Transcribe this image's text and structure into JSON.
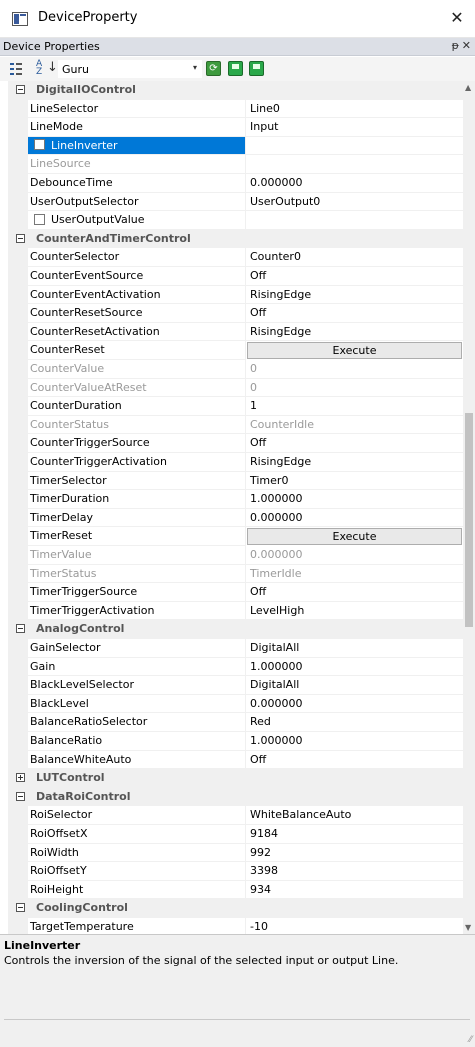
{
  "window": {
    "title": "DeviceProperty",
    "close_glyph": "✕"
  },
  "panel": {
    "header": "Device Properties",
    "pin_glyph": "ᵽ",
    "close_glyph": "✕"
  },
  "toolbar": {
    "az_label": "A\nZ",
    "visibility_value": "Guru",
    "dropdown_glyph": "▾",
    "refresh_glyph": "⟳"
  },
  "colors": {
    "selection": "#0078d7",
    "category_bg": "#f0f0f0",
    "grid_line": "#f0f0f0"
  },
  "rows": [
    {
      "kind": "cat",
      "name": "DigitalIOControl",
      "expanded": true
    },
    {
      "name": "LineSelector",
      "value": "Line0"
    },
    {
      "name": "LineMode",
      "value": "Input"
    },
    {
      "name": "LineInverter",
      "value": "",
      "checkbox": true,
      "selected": true
    },
    {
      "name": "LineSource",
      "value": "",
      "dim": true
    },
    {
      "name": "DebounceTime",
      "value": "0.000000"
    },
    {
      "name": "UserOutputSelector",
      "value": "UserOutput0"
    },
    {
      "name": "UserOutputValue",
      "value": "",
      "checkbox": true
    },
    {
      "kind": "cat",
      "name": "CounterAndTimerControl",
      "expanded": true
    },
    {
      "name": "CounterSelector",
      "value": "Counter0"
    },
    {
      "name": "CounterEventSource",
      "value": "Off"
    },
    {
      "name": "CounterEventActivation",
      "value": "RisingEdge"
    },
    {
      "name": "CounterResetSource",
      "value": "Off"
    },
    {
      "name": "CounterResetActivation",
      "value": "RisingEdge"
    },
    {
      "name": "CounterReset",
      "button": "Execute"
    },
    {
      "name": "CounterValue",
      "value": "0",
      "dim": true
    },
    {
      "name": "CounterValueAtReset",
      "value": "0",
      "dim": true
    },
    {
      "name": "CounterDuration",
      "value": "1"
    },
    {
      "name": "CounterStatus",
      "value": "CounterIdle",
      "dim": true
    },
    {
      "name": "CounterTriggerSource",
      "value": "Off"
    },
    {
      "name": "CounterTriggerActivation",
      "value": "RisingEdge"
    },
    {
      "name": "TimerSelector",
      "value": "Timer0"
    },
    {
      "name": "TimerDuration",
      "value": "1.000000"
    },
    {
      "name": "TimerDelay",
      "value": "0.000000"
    },
    {
      "name": "TimerReset",
      "button": "Execute"
    },
    {
      "name": "TimerValue",
      "value": "0.000000",
      "dim": true
    },
    {
      "name": "TimerStatus",
      "value": "TimerIdle",
      "dim": true
    },
    {
      "name": "TimerTriggerSource",
      "value": "Off"
    },
    {
      "name": "TimerTriggerActivation",
      "value": "LevelHigh"
    },
    {
      "kind": "cat",
      "name": "AnalogControl",
      "expanded": true
    },
    {
      "name": "GainSelector",
      "value": "DigitalAll"
    },
    {
      "name": "Gain",
      "value": "1.000000"
    },
    {
      "name": "BlackLevelSelector",
      "value": "DigitalAll"
    },
    {
      "name": "BlackLevel",
      "value": "0.000000"
    },
    {
      "name": "BalanceRatioSelector",
      "value": "Red"
    },
    {
      "name": "BalanceRatio",
      "value": "1.000000"
    },
    {
      "name": "BalanceWhiteAuto",
      "value": "Off"
    },
    {
      "kind": "cat",
      "name": "LUTControl",
      "expanded": false
    },
    {
      "kind": "cat",
      "name": "DataRoiControl",
      "expanded": true
    },
    {
      "name": "RoiSelector",
      "value": "WhiteBalanceAuto"
    },
    {
      "name": "RoiOffsetX",
      "value": "9184"
    },
    {
      "name": "RoiWidth",
      "value": "992"
    },
    {
      "name": "RoiOffsetY",
      "value": "3398"
    },
    {
      "name": "RoiHeight",
      "value": "934"
    },
    {
      "kind": "cat",
      "name": "CoolingControl",
      "expanded": true
    },
    {
      "name": "TargetTemperature",
      "value": "-10"
    }
  ],
  "scroll": {
    "position": 0.52
  },
  "description": {
    "title": "LineInverter",
    "text": "Controls the inversion of the signal of the selected input or output Line."
  }
}
